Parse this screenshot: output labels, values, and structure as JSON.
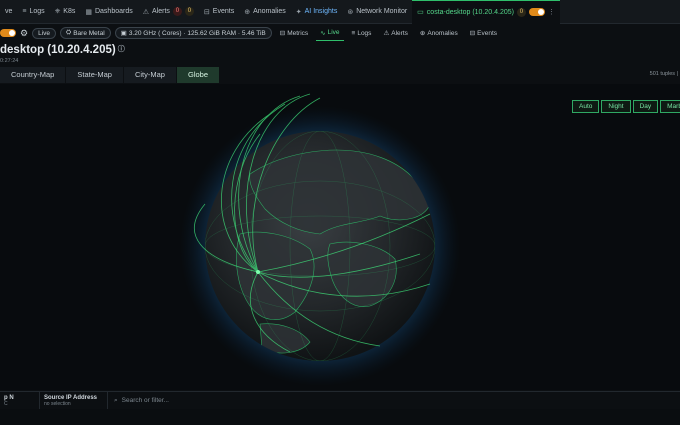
{
  "tabs": [
    {
      "label": "ve",
      "icon": ""
    },
    {
      "label": "Logs",
      "icon": "≡"
    },
    {
      "label": "K8s",
      "icon": "⎈"
    },
    {
      "label": "Dashboards",
      "icon": "▦"
    },
    {
      "label": "Alerts",
      "icon": "⚠",
      "badge1": "0",
      "badge2": "0"
    },
    {
      "label": "Events",
      "icon": "⊟"
    },
    {
      "label": "Anomalies",
      "icon": "⊕"
    },
    {
      "label": "AI Insights",
      "icon": "✦"
    },
    {
      "label": "Network Monitor",
      "icon": "⊛"
    },
    {
      "label": "costa-desktop (10.20.4.205)",
      "icon": "▭",
      "badge": "0"
    }
  ],
  "row2": {
    "live_pill": "Live",
    "bare_metal": "Bare Metal",
    "specs": "3.20 GHz ( Cores) · 125.62 GiB RAM · 5.46 TiB",
    "subtabs": [
      "Metrics",
      "Live",
      "Logs",
      "Alerts",
      "Anomalies",
      "Events"
    ]
  },
  "page": {
    "title": "desktop (10.20.4.205)",
    "info_icon": "ⓘ",
    "subtitle": "0:27:24"
  },
  "map_tabs": [
    "Country-Map",
    "State-Map",
    "City-Map",
    "Globe"
  ],
  "active_map_tab": "Globe",
  "tuples": "501 tuples | ",
  "modes": [
    "Auto",
    "Night",
    "Day",
    "Marble"
  ],
  "bottom": {
    "col1_header": "p N",
    "col1_sub": "C",
    "col2_header": "Source IP Address",
    "col2_sub": "no selection",
    "search_placeholder": "Search or filter..."
  },
  "colors": {
    "accent_green": "#2fbf6b",
    "globe_glow": "#1e6fb4",
    "arc_green": "#3fe07a"
  }
}
